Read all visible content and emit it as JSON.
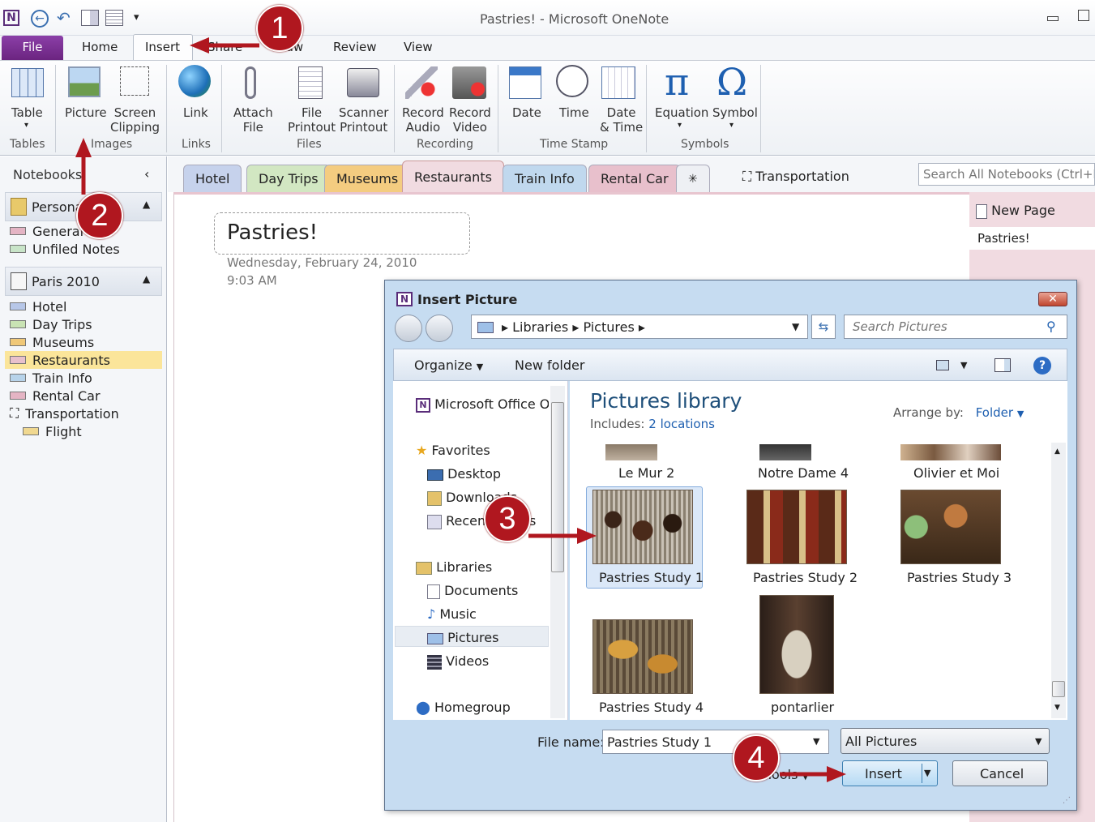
{
  "window": {
    "title": "Pastries! - Microsoft OneNote"
  },
  "ribbon_tabs": [
    "File",
    "Home",
    "Insert",
    "Share",
    "Draw",
    "Review",
    "View"
  ],
  "ribbon": {
    "table": "Table",
    "picture": "Picture",
    "screen_clipping": [
      "Screen",
      "Clipping"
    ],
    "link": "Link",
    "attach_file": [
      "Attach",
      "File"
    ],
    "file_printout": [
      "File",
      "Printout"
    ],
    "scanner_printout": [
      "Scanner",
      "Printout"
    ],
    "record_audio": [
      "Record",
      "Audio"
    ],
    "record_video": [
      "Record",
      "Video"
    ],
    "date": "Date",
    "time": "Time",
    "date_time": [
      "Date",
      "& Time"
    ],
    "equation": "Equation",
    "symbol": "Symbol",
    "groups": {
      "tables": "Tables",
      "images": "Images",
      "links": "Links",
      "files": "Files",
      "recording": "Recording",
      "time_stamp": "Time Stamp",
      "symbols": "Symbols"
    }
  },
  "nav": {
    "title": "Notebooks",
    "personal": "Personal",
    "personal_items": [
      "General",
      "Unfiled Notes"
    ],
    "paris": "Paris 2010",
    "paris_items": [
      "Hotel",
      "Day Trips",
      "Museums",
      "Restaurants",
      "Train Info",
      "Rental Car",
      "Transportation"
    ],
    "flight": "Flight"
  },
  "section_tabs": [
    "Hotel",
    "Day Trips",
    "Museums",
    "Restaurants",
    "Train Info",
    "Rental Car"
  ],
  "transportation_tab": "Transportation",
  "search_notebooks": {
    "placeholder": "Search All Notebooks (Ctrl+E)"
  },
  "page": {
    "title": "Pastries!",
    "date": "Wednesday, February 24, 2010",
    "time": "9:03 AM"
  },
  "page_list": {
    "new_page": "New Page",
    "pages": [
      "Pastries!"
    ]
  },
  "dialog": {
    "title": "Insert Picture",
    "breadcrumb": [
      "Libraries",
      "Pictures"
    ],
    "search_placeholder": "Search Pictures",
    "organize": "Organize",
    "new_folder": "New folder",
    "tree": {
      "office": "Microsoft Office OneNote",
      "favorites": "Favorites",
      "desktop": "Desktop",
      "downloads": "Downloads",
      "recent": "Recent Places",
      "libraries": "Libraries",
      "documents": "Documents",
      "music": "Music",
      "pictures": "Pictures",
      "videos": "Videos",
      "homegroup": "Homegroup"
    },
    "library_title": "Pictures library",
    "includes_label": "Includes:",
    "includes_value": "2 locations",
    "arrange_label": "Arrange by:",
    "arrange_value": "Folder",
    "files_top": [
      "Le Mur 2",
      "Notre Dame 4",
      "Olivier et Moi"
    ],
    "files": [
      "Pastries Study 1",
      "Pastries Study 2",
      "Pastries Study 3",
      "Pastries Study 4",
      "pontarlier"
    ],
    "filename_label": "File name:",
    "filename_value": "Pastries Study 1",
    "filter": "All Pictures",
    "tools": "Tools",
    "insert": "Insert",
    "cancel": "Cancel"
  },
  "callouts": [
    "1",
    "2",
    "3",
    "4"
  ]
}
